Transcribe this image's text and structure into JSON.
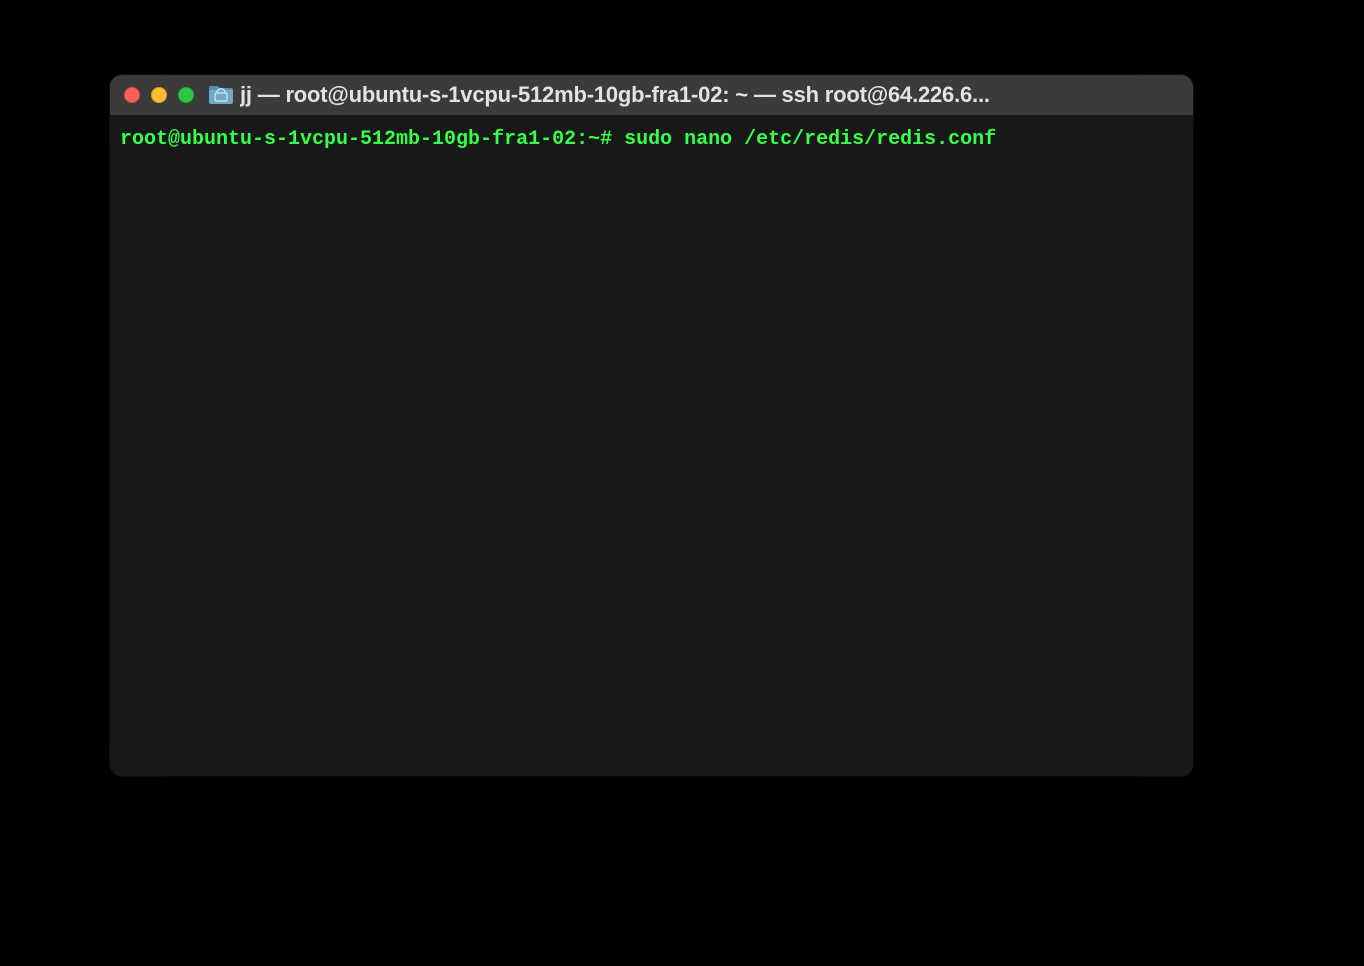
{
  "window": {
    "title": "jj — root@ubuntu-s-1vcpu-512mb-10gb-fra1-02: ~ — ssh root@64.226.6..."
  },
  "terminal": {
    "prompt": "root@ubuntu-s-1vcpu-512mb-10gb-fra1-02:~#",
    "command": "sudo nano /etc/redis/redis.conf"
  },
  "colors": {
    "close": "#ff5f57",
    "minimize": "#febc2e",
    "maximize": "#28c840",
    "prompt_fg": "#35ff48",
    "titlebar_bg": "#3c3a3b",
    "body_bg": "#181818"
  }
}
